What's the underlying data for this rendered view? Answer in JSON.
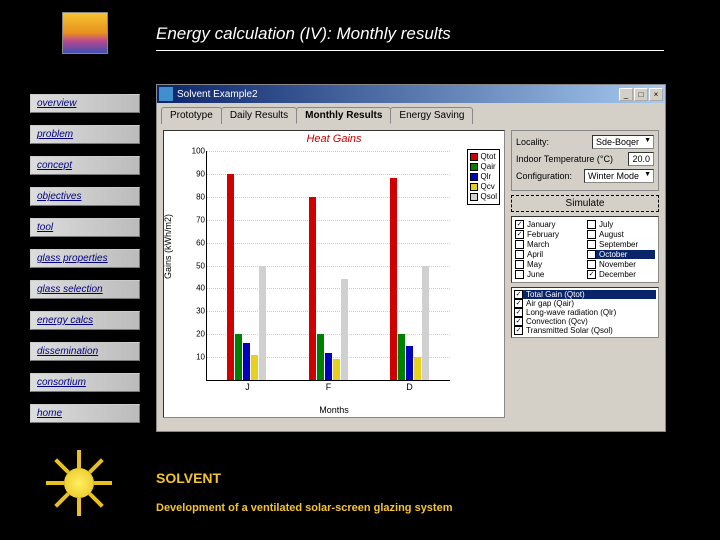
{
  "page": {
    "title": "Energy calculation (IV): Monthly results",
    "footer_title": "SOLVENT",
    "footer_subtitle": "Development of a ventilated solar-screen glazing system"
  },
  "sidebar": {
    "items": [
      {
        "label": "overview"
      },
      {
        "label": "problem"
      },
      {
        "label": "concept"
      },
      {
        "label": "objectives"
      },
      {
        "label": "tool"
      },
      {
        "label": "glass properties"
      },
      {
        "label": "glass selection"
      },
      {
        "label": "energy calcs"
      },
      {
        "label": "dissemination"
      },
      {
        "label": "consortium"
      },
      {
        "label": "home"
      }
    ]
  },
  "window": {
    "title": "Solvent Example2",
    "tabs": [
      {
        "label": "Prototype"
      },
      {
        "label": "Daily Results"
      },
      {
        "label": "Monthly Results"
      },
      {
        "label": "Energy Saving"
      }
    ],
    "active_tab": 2,
    "locality_label": "Locality:",
    "locality_value": "Sde-Boqer",
    "temp_label": "Indoor Temperature (°C)",
    "temp_value": "20.0",
    "config_label": "Configuration:",
    "config_value": "Winter Mode",
    "simulate_label": "Simulate",
    "months": [
      {
        "name": "January",
        "checked": true
      },
      {
        "name": "February",
        "checked": true
      },
      {
        "name": "March",
        "checked": false
      },
      {
        "name": "April",
        "checked": false
      },
      {
        "name": "May",
        "checked": false
      },
      {
        "name": "June",
        "checked": false
      },
      {
        "name": "July",
        "checked": false
      },
      {
        "name": "August",
        "checked": false
      },
      {
        "name": "September",
        "checked": false
      },
      {
        "name": "October",
        "checked": false,
        "selected": true
      },
      {
        "name": "November",
        "checked": false
      },
      {
        "name": "December",
        "checked": true
      }
    ],
    "gains": [
      {
        "name": "Total Gain (Qtot)",
        "checked": true,
        "selected": true
      },
      {
        "name": "Air gap (Qair)",
        "checked": true
      },
      {
        "name": "Long-wave radiation (Qlr)",
        "checked": true
      },
      {
        "name": "Convection (Qcv)",
        "checked": true
      },
      {
        "name": "Transmitted Solar (Qsol)",
        "checked": true
      }
    ]
  },
  "chart_data": {
    "type": "bar",
    "title": "Heat Gains",
    "ylabel": "Gains (kWh/m2)",
    "xlabel": "Months",
    "ylim": [
      0,
      100
    ],
    "yticks": [
      10,
      20,
      30,
      40,
      50,
      60,
      70,
      80,
      90,
      100
    ],
    "categories": [
      "J",
      "F",
      "D"
    ],
    "legend": [
      {
        "name": "Qtot",
        "color": "#d00000"
      },
      {
        "name": "Qair",
        "color": "#008000"
      },
      {
        "name": "Qlr",
        "color": "#0000c0"
      },
      {
        "name": "Qcv",
        "color": "#e8d020"
      },
      {
        "name": "Qsol",
        "color": "#d0d0d0"
      }
    ],
    "series": [
      {
        "name": "Qtot",
        "values": [
          90,
          80,
          88
        ]
      },
      {
        "name": "Qair",
        "values": [
          20,
          20,
          20
        ]
      },
      {
        "name": "Qlr",
        "values": [
          16,
          12,
          15
        ]
      },
      {
        "name": "Qcv",
        "values": [
          11,
          9,
          10
        ]
      },
      {
        "name": "Qsol",
        "values": [
          50,
          44,
          50
        ]
      }
    ]
  }
}
